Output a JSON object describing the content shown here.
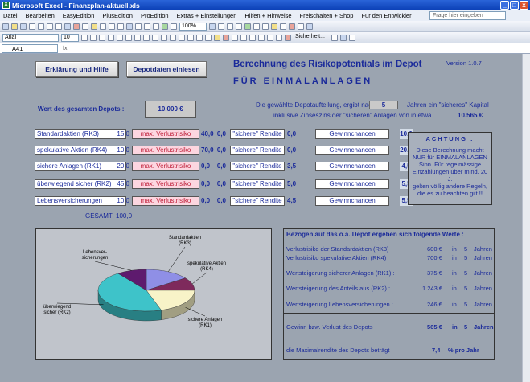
{
  "window": {
    "title": "Microsoft Excel - Finanzplan-aktuell.xls",
    "min": "_",
    "max": "□",
    "close": "x"
  },
  "menu": {
    "items": [
      "Datei",
      "Bearbeiten",
      "EasyEdition",
      "PlusEdition",
      "ProEdition",
      "Extras + Einstellungen",
      "Hilfen + Hinweise",
      "Freischalten + Shop",
      "Für den Entwickler"
    ],
    "help_placeholder": "Frage hier eingeben"
  },
  "toolbar": {
    "zoom": "100%",
    "font": "Arial",
    "size": "10",
    "security": "Sicherheit..."
  },
  "formula": {
    "cell": "A41",
    "fx": "fx"
  },
  "buttons": {
    "help": "Erklärung und Hilfe",
    "load": "Depotdaten einlesen"
  },
  "header": {
    "title": "Berechnung des Risikopotentials im Depot",
    "subtitle": "FÜR EINMALANLAGEN",
    "version": "Version 1.0.7"
  },
  "depot": {
    "label": "Wert des gesamten Depots :",
    "value": "10.000 €"
  },
  "years": {
    "text1": "Die gewählte Depotaufteilung, ergibt nach",
    "value": "5",
    "text2": "Jahren ein \"sicheres\" Kapital",
    "text3": "inklusive Zinseszins der \"sicheren\" Anlagen von in etwa",
    "capital": "10.565 €"
  },
  "rows": [
    {
      "label": "Standardaktien (RK3)",
      "pct": "15,0",
      "vr": "max. Verlustrisiko",
      "vrv": "40,0",
      "z1": "0,0",
      "sr": "\"sichere\" Rendite",
      "srv": "0,0",
      "gc": "Gewinnchancen",
      "gcv": "10,0"
    },
    {
      "label": "spekulative Aktien (RK4)",
      "pct": "10,0",
      "vr": "max. Verlustrisiko",
      "vrv": "70,0",
      "z1": "0,0",
      "sr": "\"sichere\" Rendite",
      "srv": "0,0",
      "gc": "Gewinnchancen",
      "gcv": "20,0"
    },
    {
      "label": "sichere Anlagen (RK1)",
      "pct": "20,0",
      "vr": "max. Verlustrisiko",
      "vrv": "0,0",
      "z1": "0,0",
      "sr": "\"sichere\" Rendite",
      "srv": "3,5",
      "gc": "Gewinnchancen",
      "gcv": "4,5"
    },
    {
      "label": "überwiegend sicher (RK2)",
      "pct": "45,0",
      "vr": "max. Verlustrisiko",
      "vrv": "0,0",
      "z1": "0,0",
      "sr": "\"sichere\" Rendite",
      "srv": "5,0",
      "gc": "Gewinnchancen",
      "gcv": "5,5"
    },
    {
      "label": "Lebensversicherungen",
      "pct": "10,0",
      "vr": "max. Verlustrisiko",
      "vrv": "0,0",
      "z1": "0,0",
      "sr": "\"sichere\" Rendite",
      "srv": "4,5",
      "gc": "Gewinnchancen",
      "gcv": "5,5"
    }
  ],
  "gesamt": {
    "label": "GESAMT",
    "value": "100,0"
  },
  "attention": {
    "heading": "ACHTUNG :",
    "lines": [
      "Diese Berechnung macht",
      "NUR für EINMALANLAGEN",
      "Sinn. Für regelmässige",
      "Einzahlungen über mind. 20 J.",
      "gelten völlig andere Regeln,",
      "die es zu beachten gilt !!"
    ]
  },
  "chart_data": {
    "type": "pie",
    "categories": [
      "Standardaktien (RK3)",
      "spekulative Aktien (RK4)",
      "sichere Anlagen (RK1)",
      "überwiegend sicher (RK2)",
      "Lebensversicherungen"
    ],
    "values": [
      15,
      10,
      20,
      45,
      10
    ],
    "colors": [
      "#8f8fe6",
      "#7e2a5c",
      "#f8f3c8",
      "#3ec3c9",
      "#5e1a6e"
    ]
  },
  "chart_labels": [
    [
      "Standardaktien",
      "(RK3)"
    ],
    [
      "spekulative Aktien",
      "(RK4)"
    ],
    [
      "sichere Anlagen",
      "(RK1)"
    ],
    [
      "überwiegend",
      "sicher (RK2)"
    ],
    [
      "Lebensver-",
      "sicherungen"
    ]
  ],
  "results": {
    "heading": "Bezogen auf das o.a. Depot ergeben sich folgende Werte :",
    "in": "in",
    "jahren": "Jahren",
    "rows": [
      {
        "label": "Verlustrisiko der Standardaktien (RK3)",
        "value": "600 €",
        "years": "5"
      },
      {
        "label": "Verlustrisiko spekulative Aktien (RK4)",
        "value": "700 €",
        "years": "5"
      },
      {
        "label": "Wertsteigerung sicherer Anlagen (RK1) :",
        "value": "375 €",
        "years": "5"
      },
      {
        "label": "Wertsteigerung des Anteils aus (RK2) :",
        "value": "1.243 €",
        "years": "5"
      },
      {
        "label": "Wertsteigerung Lebensversicherungen :",
        "value": "246 €",
        "years": "5"
      }
    ],
    "gain_label": "Gewinn bzw. Verlust des Depots",
    "gain_value": "565 €",
    "gain_years": "5",
    "max_label": "die Maximalrendite des Depots beträgt",
    "max_value": "7,4",
    "max_unit": "% pro Jahr"
  }
}
